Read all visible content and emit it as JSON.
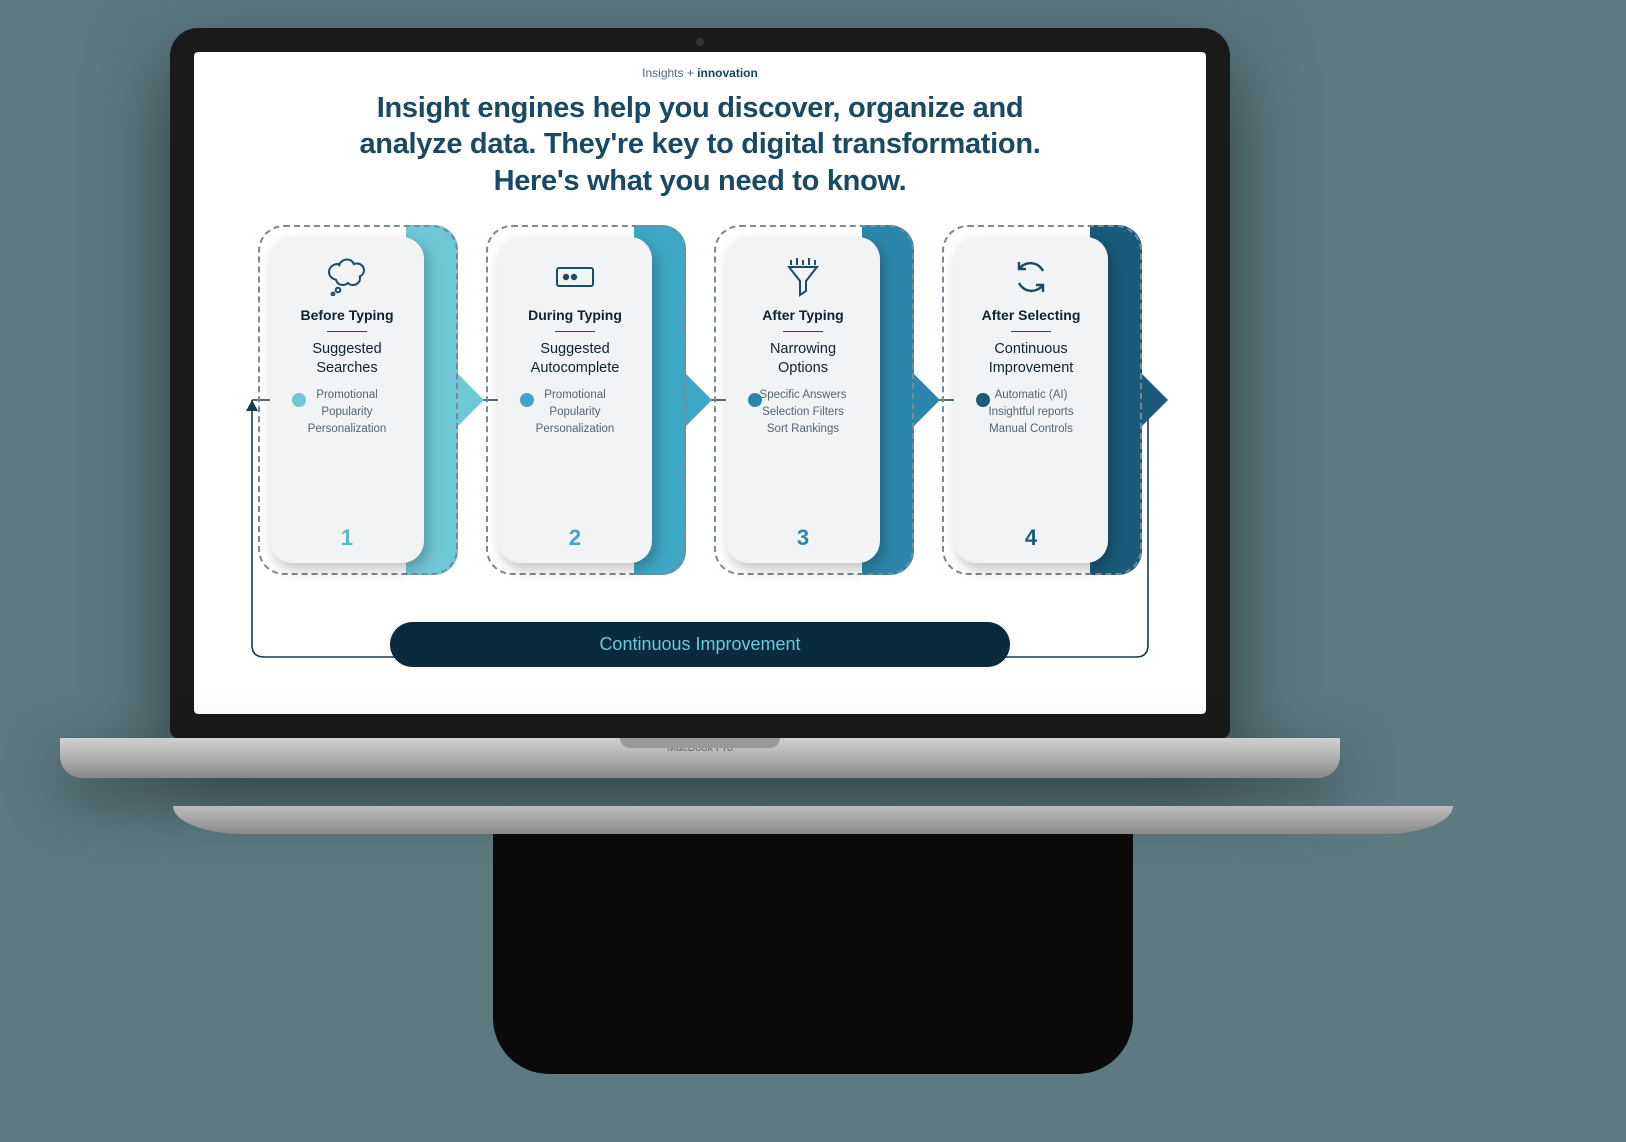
{
  "eyebrow_prefix": "Insights + ",
  "eyebrow_bold": "innovation",
  "hero": "Insight engines help you discover, organize and analyze data. They're key to digital transformation. Here's what you need to know.",
  "stages": [
    {
      "phase": "Before Typing",
      "headline": "Suggested\nSearches",
      "details": "Promotional\nPopularity\nPersonalization",
      "num": "1"
    },
    {
      "phase": "During Typing",
      "headline": "Suggested\nAutocomplete",
      "details": "Promotional\nPopularity\nPersonalization",
      "num": "2"
    },
    {
      "phase": "After Typing",
      "headline": "Narrowing\nOptions",
      "details": "Specific Answers\nSelection Filters\nSort Rankings",
      "num": "3"
    },
    {
      "phase": "After Selecting",
      "headline": "Continuous\nImprovement",
      "details": "Automatic (AI)\nInsightful reports\nManual Controls",
      "num": "4"
    }
  ],
  "loop_label": "Continuous Improvement",
  "device_label": "MacBook Pro"
}
